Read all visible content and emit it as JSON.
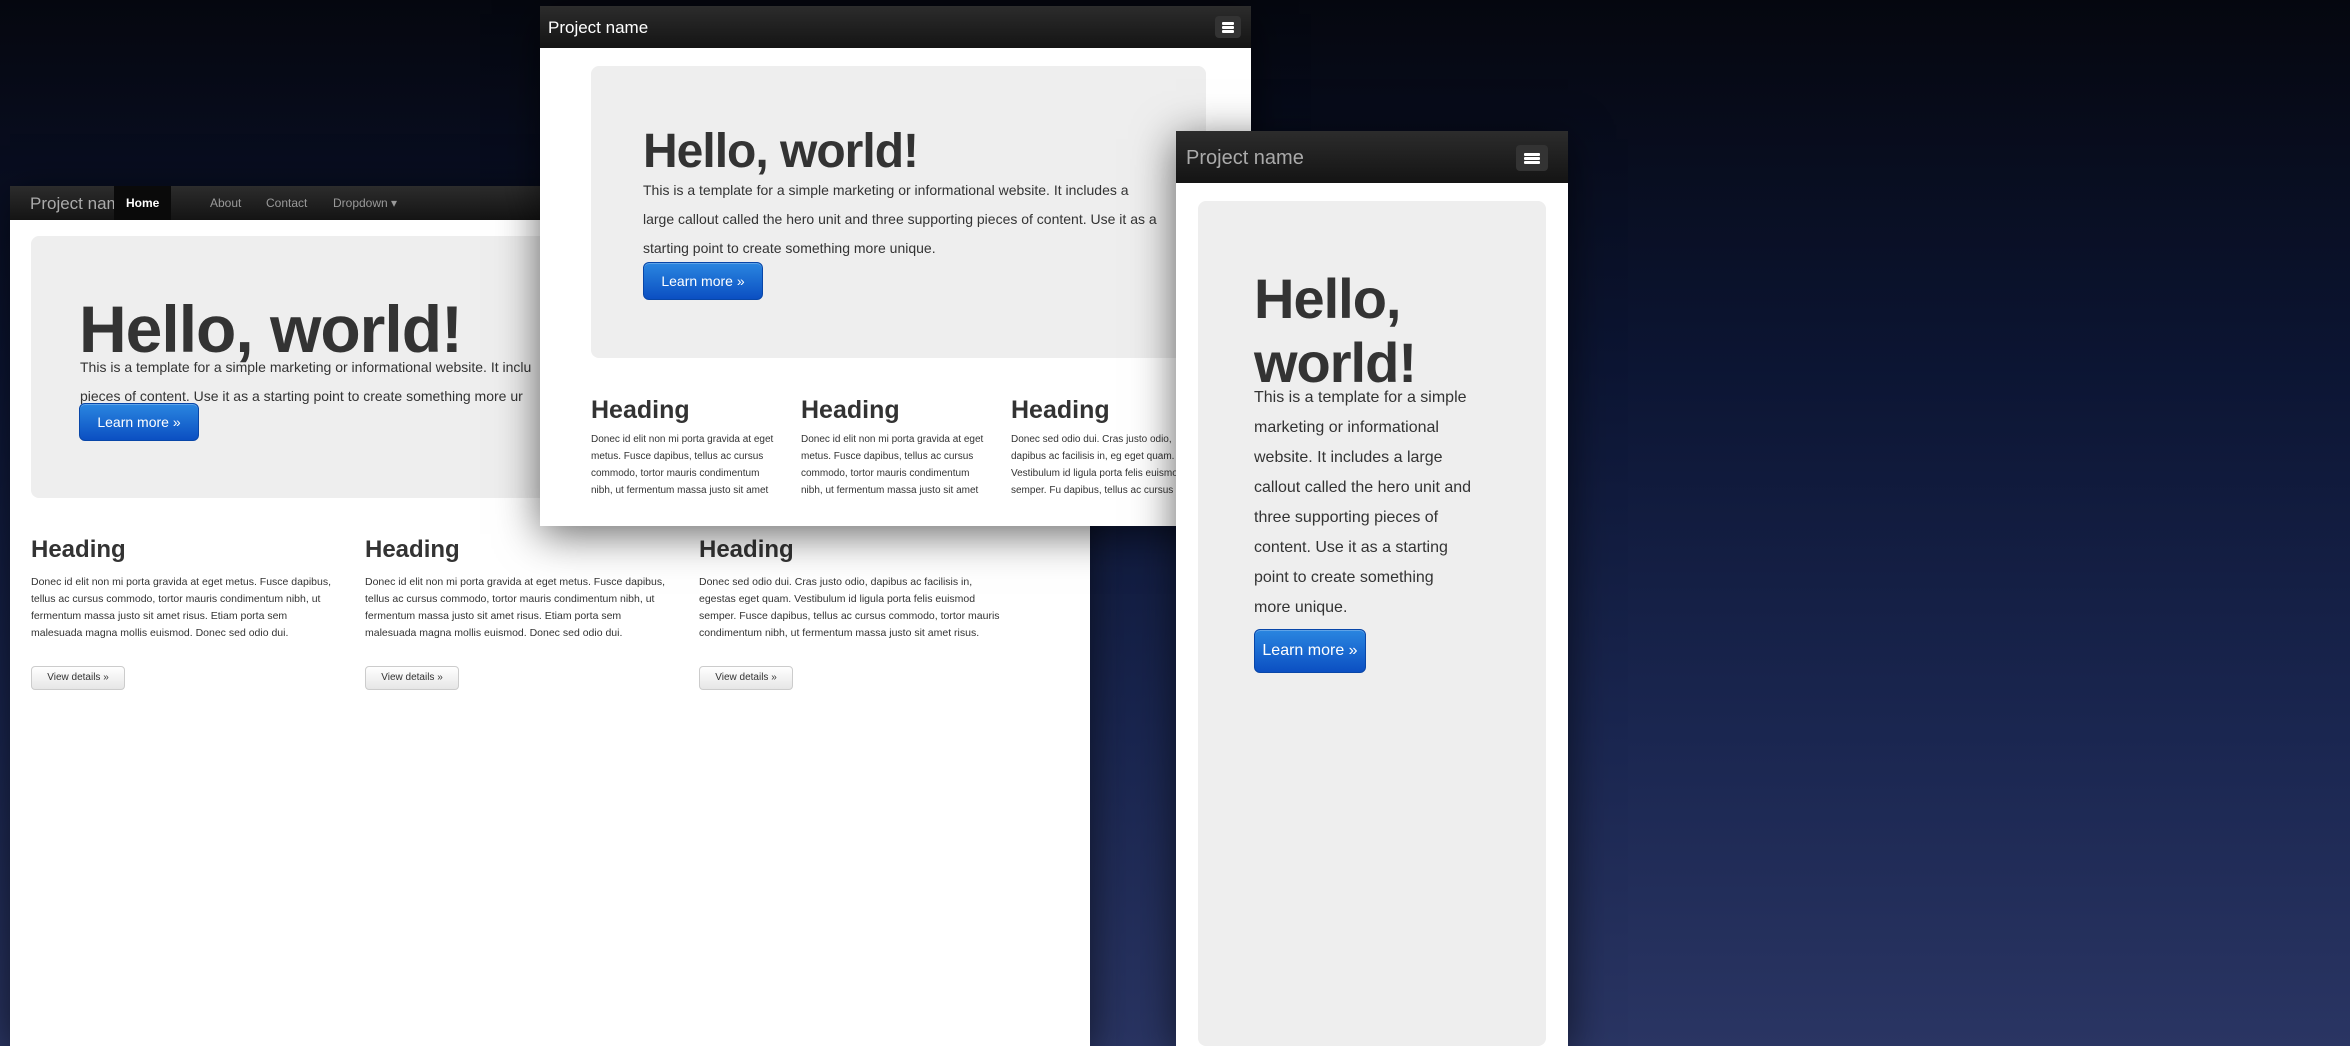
{
  "brand": "Project name",
  "nav": {
    "home": "Home",
    "about": "About",
    "contact": "Contact",
    "dropdown": "Dropdown ▾"
  },
  "hero": {
    "title": "Hello, world!",
    "text": "This is a template for a simple marketing or informational website. It includes a large callout called the hero unit and three supporting pieces of content. Use it as a starting point to create something more unique.",
    "button": "Learn more »"
  },
  "columns": [
    {
      "heading": "Heading",
      "text": "Donec id elit non mi porta gravida at eget metus. Fusce dapibus, tellus ac cursus commodo, tortor mauris condimentum nibh, ut fermentum massa justo sit amet risus. Etiam porta sem malesuada magna mollis euismod. Donec sed odio dui.",
      "button": "View details »"
    },
    {
      "heading": "Heading",
      "text": "Donec id elit non mi porta gravida at eget metus. Fusce dapibus, tellus ac cursus commodo, tortor mauris condimentum nibh, ut fermentum massa justo sit amet risus. Etiam porta sem malesuada magna mollis euismod. Donec sed odio dui.",
      "button": "View details »"
    },
    {
      "heading": "Heading",
      "text": "Donec sed odio dui. Cras justo odio, dapibus ac facilisis in, egestas eget quam. Vestibulum id ligula porta felis euismod semper. Fusce dapibus, tellus ac cursus commodo, tortor mauris condimentum nibh, ut fermentum massa justo sit amet risus.",
      "button": "View details »"
    }
  ],
  "columns_medium": [
    {
      "heading": "Heading",
      "text": "Donec id elit non mi porta gravida at eget metus. Fusce dapibus, tellus ac cursus commodo, tortor mauris condimentum nibh, ut fermentum massa justo sit amet"
    },
    {
      "heading": "Heading",
      "text": "Donec id elit non mi porta gravida at eget metus. Fusce dapibus, tellus ac cursus commodo, tortor mauris condimentum nibh, ut fermentum massa justo sit amet"
    },
    {
      "heading": "Heading",
      "text": "Donec sed odio dui. Cras justo odio, dapibus ac facilisis in, eg eget quam. Vestibulum id ligula porta felis euismod semper. Fu dapibus, tellus ac cursus"
    }
  ],
  "small_hero_title": [
    "Hello,",
    "world!"
  ],
  "small_hero_lines": [
    "This is a template for a simple",
    "marketing or informational",
    "website. It includes a large",
    "callout called the hero unit and",
    "three supporting pieces of",
    "content. Use it as a starting",
    "point to create something",
    "more unique."
  ],
  "large_hero_lines": [
    "This is a template for a simple marketing or informational website. It inclu",
    "pieces of content. Use it as a starting point to create something more ur"
  ],
  "icons": {
    "menu": "menu-icon"
  }
}
